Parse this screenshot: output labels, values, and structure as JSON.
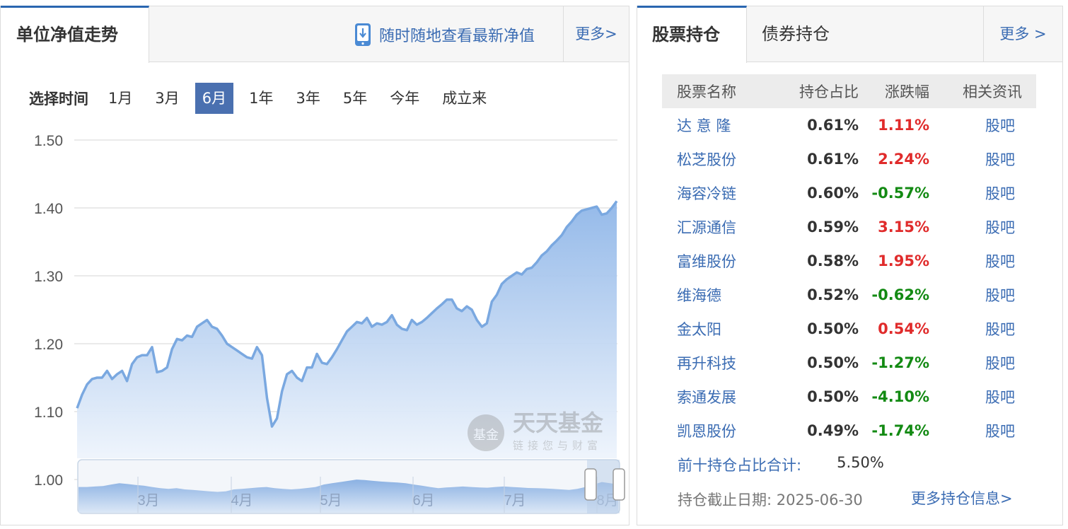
{
  "left": {
    "tab_title": "单位净值走势",
    "promo_text": "随时随地查看最新净值",
    "more_label": "更多>",
    "range_label": "选择时间",
    "ranges": [
      "1月",
      "3月",
      "6月",
      "1年",
      "3年",
      "5年",
      "今年",
      "成立来"
    ],
    "active_range": "6月",
    "watermark": {
      "name": "天天基金",
      "slogan": "链接您与财富",
      "badge": "基金"
    }
  },
  "chart_data": {
    "type": "area",
    "ylim": [
      1.0,
      1.5
    ],
    "yticks": [
      "1.50",
      "1.40",
      "1.30",
      "1.20",
      "1.10",
      "1.00"
    ],
    "grid": true,
    "colors": {
      "line": "#7aa8e0",
      "fill_top": "#8fb6e8",
      "fill_bottom": "#eef4fc"
    },
    "y": [
      1.105,
      1.125,
      1.14,
      1.148,
      1.15,
      1.15,
      1.16,
      1.148,
      1.155,
      1.16,
      1.145,
      1.17,
      1.18,
      1.183,
      1.183,
      1.195,
      1.158,
      1.16,
      1.165,
      1.192,
      1.207,
      1.205,
      1.212,
      1.21,
      1.225,
      1.23,
      1.235,
      1.225,
      1.222,
      1.212,
      1.2,
      1.195,
      1.19,
      1.185,
      1.18,
      1.178,
      1.195,
      1.183,
      1.12,
      1.078,
      1.09,
      1.13,
      1.155,
      1.16,
      1.15,
      1.145,
      1.165,
      1.165,
      1.185,
      1.172,
      1.17,
      1.18,
      1.192,
      1.205,
      1.218,
      1.225,
      1.232,
      1.23,
      1.238,
      1.225,
      1.23,
      1.228,
      1.232,
      1.242,
      1.228,
      1.222,
      1.22,
      1.235,
      1.228,
      1.232,
      1.238,
      1.245,
      1.252,
      1.258,
      1.265,
      1.265,
      1.252,
      1.248,
      1.255,
      1.25,
      1.235,
      1.225,
      1.23,
      1.262,
      1.272,
      1.288,
      1.295,
      1.3,
      1.305,
      1.302,
      1.31,
      1.312,
      1.32,
      1.33,
      1.336,
      1.345,
      1.352,
      1.36,
      1.372,
      1.38,
      1.39,
      1.396,
      1.398,
      1.4,
      1.402,
      1.39,
      1.392,
      1.4,
      1.41
    ],
    "navigator": {
      "months": [
        "3月",
        "4月",
        "5月",
        "6月",
        "7月",
        "8月"
      ],
      "y": [
        0.3,
        0.3,
        0.32,
        0.34,
        0.4,
        0.45,
        0.42,
        0.38,
        0.35,
        0.3,
        0.25,
        0.22,
        0.25,
        0.2,
        0.18,
        0.15,
        0.12,
        0.1,
        0.12,
        0.2,
        0.22,
        0.25,
        0.28,
        0.3,
        0.25,
        0.22,
        0.2,
        0.22,
        0.26,
        0.3,
        0.4,
        0.45,
        0.5,
        0.55,
        0.6,
        0.58,
        0.55,
        0.52,
        0.5,
        0.48,
        0.45,
        0.4,
        0.35,
        0.3,
        0.25,
        0.28,
        0.3,
        0.32,
        0.3,
        0.28,
        0.27,
        0.3,
        0.32,
        0.3,
        0.28,
        0.26,
        0.25,
        0.24,
        0.22,
        0.2,
        0.18,
        0.22,
        0.3,
        0.4,
        0.5,
        0.45,
        0.4
      ]
    }
  },
  "right": {
    "tab_stock": "股票持仓",
    "tab_bond": "债券持仓",
    "more_label": "更多 >",
    "headers": {
      "name": "股票名称",
      "pct": "持仓占比",
      "chg": "涨跌幅",
      "news": "相关资讯"
    },
    "rows": [
      {
        "name": "达 意 隆",
        "pct": "0.61%",
        "chg": "1.11%",
        "dir": "up",
        "news": "股吧"
      },
      {
        "name": "松芝股份",
        "pct": "0.61%",
        "chg": "2.24%",
        "dir": "up",
        "news": "股吧"
      },
      {
        "name": "海容冷链",
        "pct": "0.60%",
        "chg": "-0.57%",
        "dir": "down",
        "news": "股吧"
      },
      {
        "name": "汇源通信",
        "pct": "0.59%",
        "chg": "3.15%",
        "dir": "up",
        "news": "股吧"
      },
      {
        "name": "富维股份",
        "pct": "0.58%",
        "chg": "1.95%",
        "dir": "up",
        "news": "股吧"
      },
      {
        "name": "维海德",
        "pct": "0.52%",
        "chg": "-0.62%",
        "dir": "down",
        "news": "股吧"
      },
      {
        "name": "金太阳",
        "pct": "0.50%",
        "chg": "0.54%",
        "dir": "up",
        "news": "股吧"
      },
      {
        "name": "再升科技",
        "pct": "0.50%",
        "chg": "-1.27%",
        "dir": "down",
        "news": "股吧"
      },
      {
        "name": "索通发展",
        "pct": "0.50%",
        "chg": "-4.10%",
        "dir": "down",
        "news": "股吧"
      },
      {
        "name": "凯恩股份",
        "pct": "0.49%",
        "chg": "-1.74%",
        "dir": "down",
        "news": "股吧"
      }
    ],
    "summary_label": "前十持仓占比合计:",
    "summary_value": "5.50%",
    "as_of": "持仓截止日期: 2025-06-30",
    "more_holdings": "更多持仓信息>"
  }
}
